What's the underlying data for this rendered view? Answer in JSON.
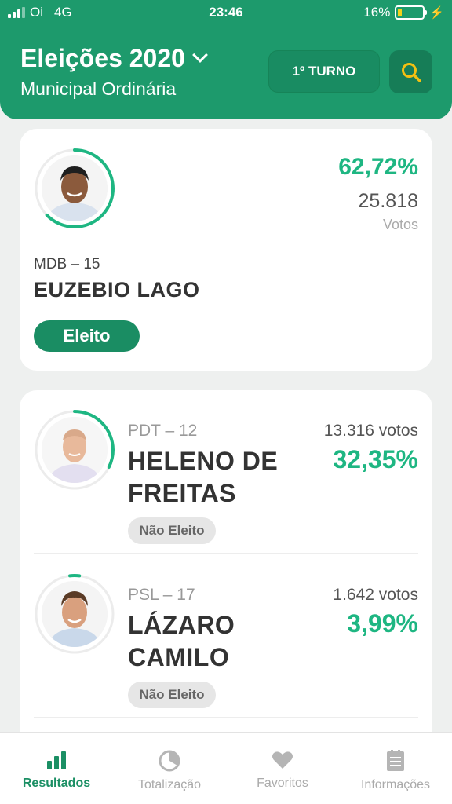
{
  "status_bar": {
    "carrier": "Oi",
    "network": "4G",
    "time": "23:46",
    "battery": "16%"
  },
  "header": {
    "title": "Eleições 2020",
    "subtitle": "Municipal Ordinária",
    "turno_label": "1º TURNO"
  },
  "winner": {
    "percent": "62,72%",
    "percent_value": 62.72,
    "votes": "25.818",
    "votes_label": "Votos",
    "party": "MDB – 15",
    "name": "EUZEBIO LAGO",
    "status": "Eleito"
  },
  "candidates": [
    {
      "party": "PDT – 12",
      "name": "HELENO DE FREITAS",
      "votes": "13.316 votos",
      "percent": "32,35%",
      "percent_value": 32.35,
      "status": "Não Eleito"
    },
    {
      "party": "PSL – 17",
      "name": "LÁZARO CAMILO",
      "votes": "1.642 votos",
      "percent": "3,99%",
      "percent_value": 3.99,
      "status": "Não Eleito"
    }
  ],
  "nav": {
    "active": "results",
    "items": [
      {
        "label": "Resultados",
        "icon": "bar-chart-icon"
      },
      {
        "label": "Totalização",
        "icon": "pie-chart-icon"
      },
      {
        "label": "Favoritos",
        "icon": "heart-icon"
      },
      {
        "label": "Informações",
        "icon": "document-icon"
      }
    ]
  },
  "colors": {
    "primary": "#1d9a6c",
    "accent": "#1eb682",
    "search_icon": "#f2c012"
  }
}
